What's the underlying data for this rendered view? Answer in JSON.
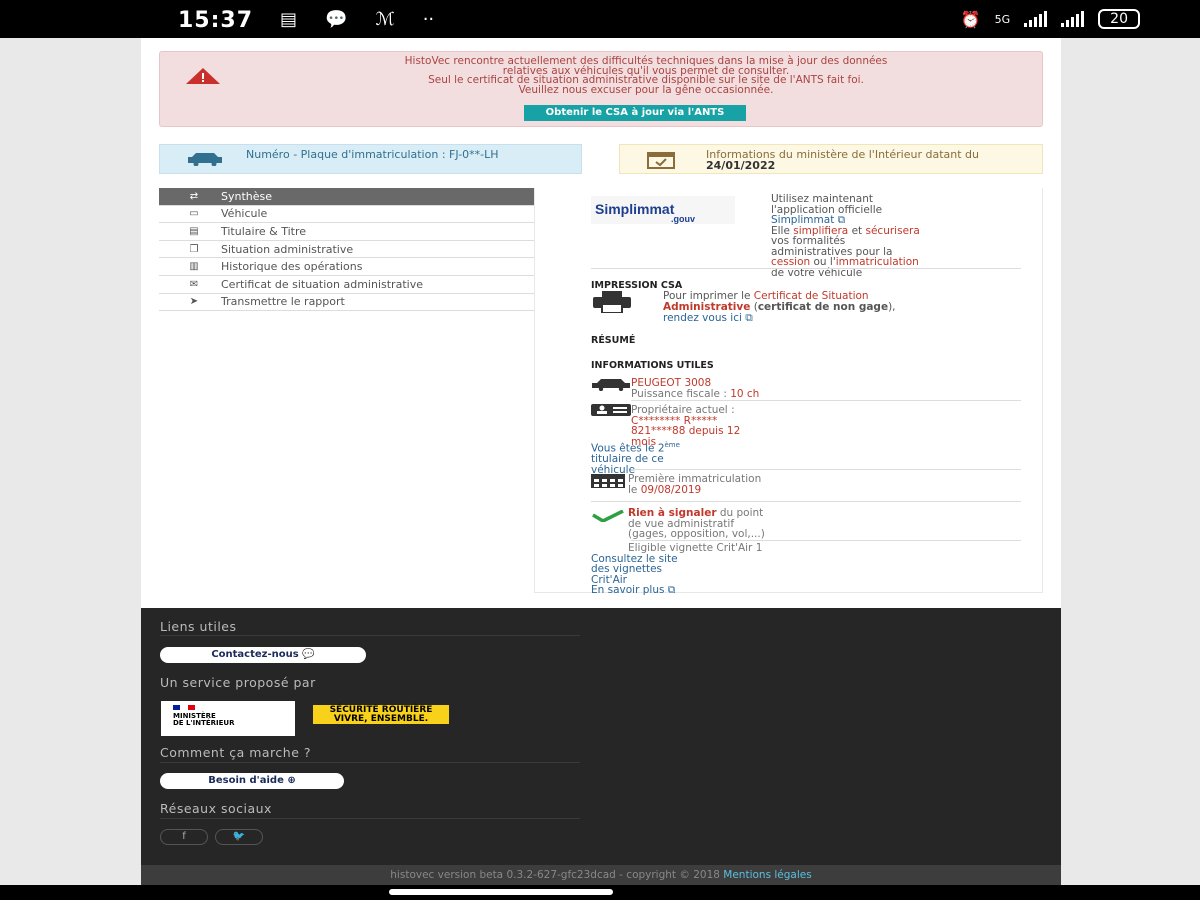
{
  "status": {
    "time": "15:37",
    "network": "5G",
    "battery": "20"
  },
  "alert": {
    "lines": [
      "HistoVec rencontre actuellement des difficultés techniques dans la mise à jour des données",
      "relatives aux véhicules qu'il vous permet de consulter.",
      "Seul le certificat de situation administrative disponible sur le site de l'ANTS fait foi.",
      "Veuillez nous excuser pour la gêne occasionnée."
    ],
    "button": "Obtenir le CSA à jour via l'ANTS"
  },
  "plate_card": {
    "text": "Numéro - Plaque d'immatriculation : FJ-0**-LH"
  },
  "info_card": {
    "text": "Informations du ministère de l'Intérieur datant du",
    "date": "24/01/2022"
  },
  "menu": [
    {
      "label": "Synthèse",
      "icon": "sync-icon",
      "glyph": "⇄"
    },
    {
      "label": "Véhicule",
      "icon": "car-icon",
      "glyph": "🚗"
    },
    {
      "label": "Titulaire & Titre",
      "icon": "id-card-icon",
      "glyph": "▤"
    },
    {
      "label": "Situation administrative",
      "icon": "copy-icon",
      "glyph": "❐"
    },
    {
      "label": "Historique des opérations",
      "icon": "history-icon",
      "glyph": "▥"
    },
    {
      "label": "Certificat de situation administrative",
      "icon": "certificate-icon",
      "glyph": "✉"
    },
    {
      "label": "Transmettre le rapport",
      "icon": "send-icon",
      "glyph": "➤"
    }
  ],
  "simplimmat": {
    "logo_top": "Simplimmat",
    "logo_bottom": ".gouv",
    "l1": "Utilisez maintenant",
    "l2": "l'application officielle",
    "link": "Simplimmat",
    "l3a": "Elle ",
    "l3b": "simplifiera",
    "l3c": " et ",
    "l3d": "sécurisera",
    "l4": "vos formalités",
    "l5": "administratives pour la",
    "l6a": "cession",
    "l6b": " ou l'",
    "l6c": "immatriculation",
    "l7": "de votre véhicule"
  },
  "impression": {
    "title": "IMPRESSION CSA",
    "t1": "Pour imprimer le ",
    "t2": "Certificat de Situation",
    "t3": "Administrative",
    "t4": " (",
    "t5": "certificat de non gage",
    "t6": "),",
    "link": "rendez vous ici"
  },
  "resume": {
    "title": "RÉSUMÉ"
  },
  "infos": {
    "title": "INFORMATIONS UTILES",
    "vehicle": "PEUGEOT 3008",
    "power_label": "Puissance fiscale : ",
    "power": "10 ch",
    "owner_label": "Propriétaire actuel :",
    "owner_name": "C******** R*****",
    "owner_since": "821****88 depuis 12",
    "owner_mois": "mois",
    "titulaire1": "Vous êtes le 2",
    "titulaire_sup": "ème",
    "titulaire2": "titulaire de ce",
    "titulaire3": "véhicule",
    "first_label": "Première immatriculation",
    "first_le": "le ",
    "first_date": "09/08/2019",
    "ok1": "Rien à signaler",
    "ok1b": " du point",
    "ok2": "de vue administratif",
    "ok3": "(gages, opposition, vol,...)",
    "critair": "Eligible vignette Crit'Air 1",
    "critair_l1": "Consultez le site",
    "critair_l2": "des vignettes",
    "critair_l3": "Crit'Air",
    "more": "En savoir plus"
  },
  "footer": {
    "links_title": "Liens utiles",
    "contact": "Contactez-nous",
    "service_title": "Un service proposé par",
    "mi1": "MINISTÈRE",
    "mi2": "DE L'INTÉRIEUR",
    "sr1": "SÉCURITÉ ROUTIÈRE",
    "sr2": "VIVRE, ENSEMBLE.",
    "how_title": "Comment ça marche ?",
    "help": "Besoin d'aide",
    "social_title": "Réseaux sociaux",
    "fb": "f",
    "tw": "🐦",
    "version": "histovec version beta 0.3.2-627-gfc23dcad - copyright © 2018 ",
    "legal": "Mentions légales"
  },
  "colors": {
    "alert_bg": "#f2dede",
    "info_blue": "#d9edf7",
    "info_yellow": "#fcf8e3",
    "accent_red": "#c0392b",
    "footer_bg": "#262626"
  }
}
